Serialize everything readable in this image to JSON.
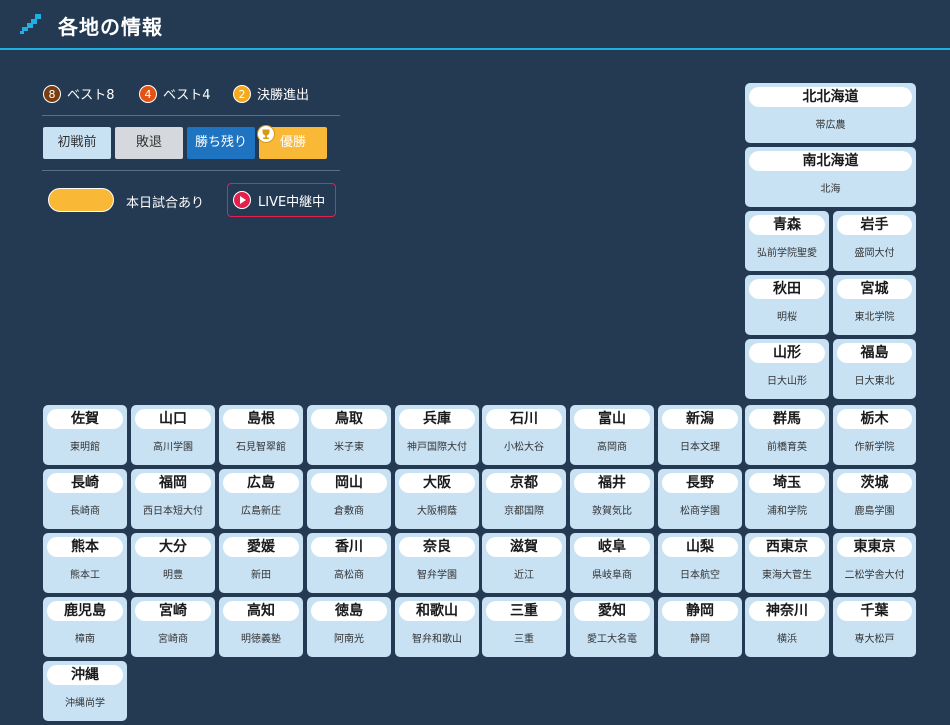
{
  "header": {
    "title": "各地の情報"
  },
  "legend": {
    "badges": [
      {
        "num": "8",
        "label": "ベスト8",
        "color": "#7a3d12"
      },
      {
        "num": "4",
        "label": "ベスト4",
        "color": "#e35314"
      },
      {
        "num": "2",
        "label": "決勝進出",
        "color": "#f6a91b"
      }
    ],
    "statuses": [
      {
        "label": "初戦前",
        "bg": "#c8e2f4",
        "fg": "#333333"
      },
      {
        "label": "敗退",
        "bg": "#d5d8dc",
        "fg": "#333333"
      },
      {
        "label": "勝ち残り",
        "bg": "#1e74c0",
        "fg": "#ffffff"
      },
      {
        "label": "優勝",
        "bg": "#f9b835",
        "fg": "#ffffff"
      }
    ],
    "today_label": "本日試合あり",
    "live_label": "LIVE中継中",
    "today_color": "#f9b835",
    "live_color": "#e0224c"
  },
  "prefectures": [
    {
      "pref": "北北海道",
      "school": "帯広農"
    },
    {
      "pref": "南北海道",
      "school": "北海"
    },
    {
      "pref": "青森",
      "school": "弘前学院聖愛"
    },
    {
      "pref": "岩手",
      "school": "盛岡大付"
    },
    {
      "pref": "秋田",
      "school": "明桜"
    },
    {
      "pref": "宮城",
      "school": "東北学院"
    },
    {
      "pref": "山形",
      "school": "日大山形"
    },
    {
      "pref": "福島",
      "school": "日大東北"
    },
    {
      "pref": "佐賀",
      "school": "東明館"
    },
    {
      "pref": "山口",
      "school": "高川学園"
    },
    {
      "pref": "島根",
      "school": "石見智翠館"
    },
    {
      "pref": "鳥取",
      "school": "米子東"
    },
    {
      "pref": "兵庫",
      "school": "神戸国際大付"
    },
    {
      "pref": "石川",
      "school": "小松大谷"
    },
    {
      "pref": "富山",
      "school": "高岡商"
    },
    {
      "pref": "新潟",
      "school": "日本文理"
    },
    {
      "pref": "群馬",
      "school": "前橋育英"
    },
    {
      "pref": "栃木",
      "school": "作新学院"
    },
    {
      "pref": "長崎",
      "school": "長崎商"
    },
    {
      "pref": "福岡",
      "school": "西日本短大付"
    },
    {
      "pref": "広島",
      "school": "広島新庄"
    },
    {
      "pref": "岡山",
      "school": "倉敷商"
    },
    {
      "pref": "大阪",
      "school": "大阪桐蔭"
    },
    {
      "pref": "京都",
      "school": "京都国際"
    },
    {
      "pref": "福井",
      "school": "敦賀気比"
    },
    {
      "pref": "長野",
      "school": "松商学園"
    },
    {
      "pref": "埼玉",
      "school": "浦和学院"
    },
    {
      "pref": "茨城",
      "school": "鹿島学園"
    },
    {
      "pref": "熊本",
      "school": "熊本工"
    },
    {
      "pref": "大分",
      "school": "明豊"
    },
    {
      "pref": "愛媛",
      "school": "新田"
    },
    {
      "pref": "香川",
      "school": "高松商"
    },
    {
      "pref": "奈良",
      "school": "智弁学園"
    },
    {
      "pref": "滋賀",
      "school": "近江"
    },
    {
      "pref": "岐阜",
      "school": "県岐阜商"
    },
    {
      "pref": "山梨",
      "school": "日本航空"
    },
    {
      "pref": "西東京",
      "school": "東海大菅生"
    },
    {
      "pref": "東東京",
      "school": "二松学舎大付"
    },
    {
      "pref": "鹿児島",
      "school": "樟南"
    },
    {
      "pref": "宮崎",
      "school": "宮崎商"
    },
    {
      "pref": "高知",
      "school": "明徳義塾"
    },
    {
      "pref": "徳島",
      "school": "阿南光"
    },
    {
      "pref": "和歌山",
      "school": "智弁和歌山"
    },
    {
      "pref": "三重",
      "school": "三重"
    },
    {
      "pref": "愛知",
      "school": "愛工大名電"
    },
    {
      "pref": "静岡",
      "school": "静岡"
    },
    {
      "pref": "神奈川",
      "school": "横浜"
    },
    {
      "pref": "千葉",
      "school": "専大松戸"
    },
    {
      "pref": "沖縄",
      "school": "沖縄尚学"
    }
  ]
}
